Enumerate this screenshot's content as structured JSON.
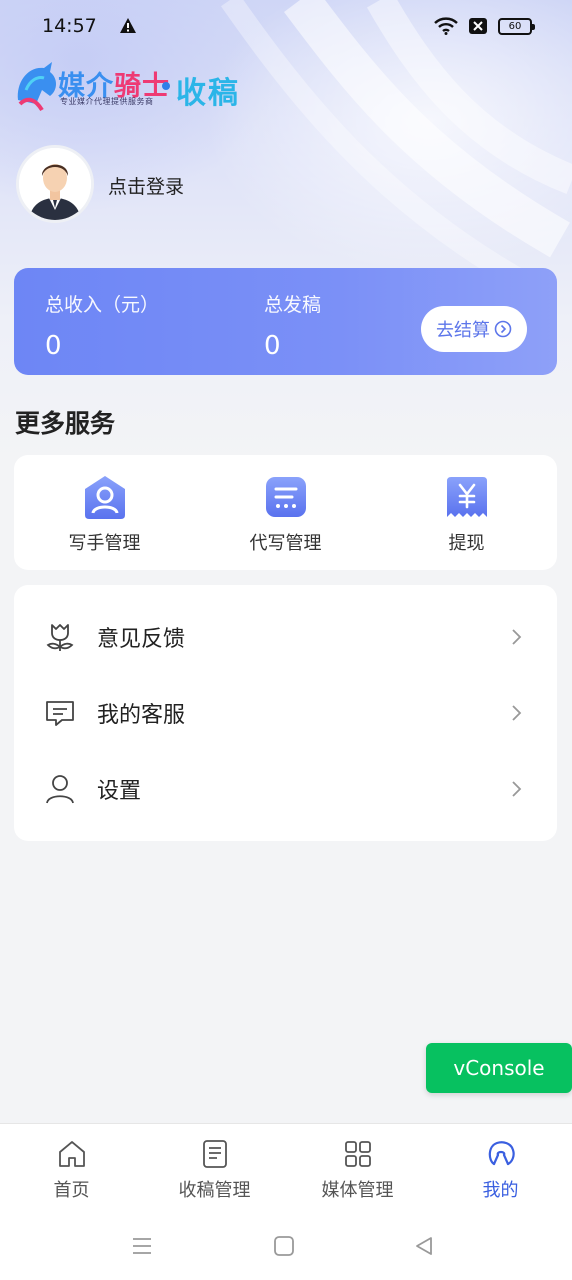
{
  "status_bar": {
    "time": "14:57",
    "battery": "60",
    "icons": [
      "warning-icon",
      "wifi-icon",
      "sim-blocked-icon",
      "battery-icon"
    ]
  },
  "logo": {
    "brand_part1": "媒介",
    "brand_part2": "骑士",
    "tagline": "专业媒介代理提供服务商",
    "product": "收稿"
  },
  "user": {
    "login_prompt": "点击登录"
  },
  "stats": {
    "income_label": "总收入（元）",
    "income_value": "0",
    "posts_label": "总发稿",
    "posts_value": "0",
    "settle_label": "去结算"
  },
  "services": {
    "title": "更多服务",
    "items": [
      {
        "label": "写手管理",
        "icon": "writer-icon"
      },
      {
        "label": "代写管理",
        "icon": "ghostwrite-icon"
      },
      {
        "label": "提现",
        "icon": "withdraw-icon"
      }
    ]
  },
  "menu": {
    "items": [
      {
        "label": "意见反馈",
        "icon": "flower-icon"
      },
      {
        "label": "我的客服",
        "icon": "chat-icon"
      },
      {
        "label": "设置",
        "icon": "user-icon"
      }
    ]
  },
  "vconsole": {
    "label": "vConsole"
  },
  "tabbar": {
    "items": [
      {
        "label": "首页",
        "icon": "home-icon",
        "active": false
      },
      {
        "label": "收稿管理",
        "icon": "document-icon",
        "active": false
      },
      {
        "label": "媒体管理",
        "icon": "grid-icon",
        "active": false
      },
      {
        "label": "我的",
        "icon": "profile-icon",
        "active": true
      }
    ]
  },
  "colors": {
    "accent": "#6d86f5",
    "tab_active": "#3a5fe0",
    "vconsole": "#07c160"
  }
}
